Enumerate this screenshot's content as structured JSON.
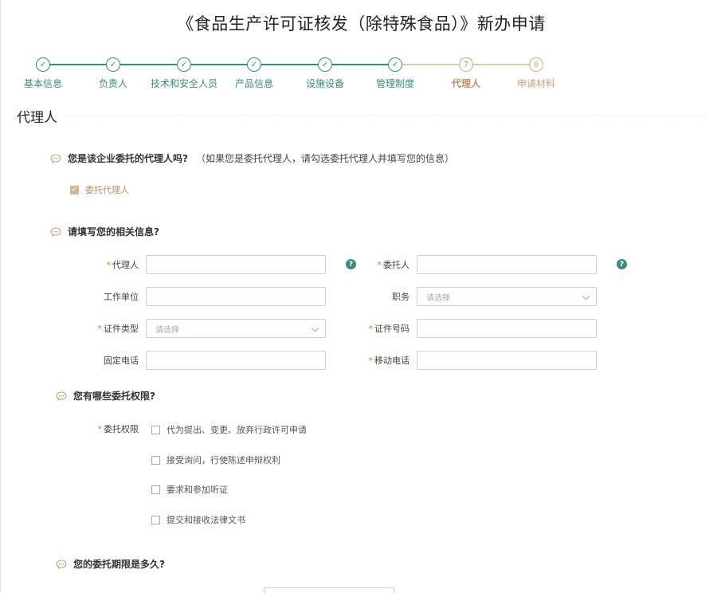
{
  "page_title": "《食品生产许可证核发（除特殊食品）》新办申请",
  "steps": [
    {
      "label": "基本信息",
      "marker": "✓",
      "state": "done"
    },
    {
      "label": "负责人",
      "marker": "✓",
      "state": "done"
    },
    {
      "label": "技术和安全人员",
      "marker": "✓",
      "state": "done"
    },
    {
      "label": "产品信息",
      "marker": "✓",
      "state": "done"
    },
    {
      "label": "设施设备",
      "marker": "✓",
      "state": "done"
    },
    {
      "label": "管理制度",
      "marker": "✓",
      "state": "done"
    },
    {
      "label": "代理人",
      "marker": "7",
      "state": "active"
    },
    {
      "label": "申请材料",
      "marker": "8",
      "state": "pending"
    }
  ],
  "section_title": "代理人",
  "q1": {
    "text": "您是该企业委托的代理人吗?",
    "note": "（如果您是委托代理人，请勾选委托代理人并填写您的信息）",
    "checkbox_label": "委托代理人",
    "checked": true
  },
  "q2": {
    "text": "请填写您的相关信息?",
    "fields": {
      "agent_label": "代理人",
      "agent_value": "",
      "principal_label": "委托人",
      "principal_value": "",
      "employer_label": "工作单位",
      "employer_value": "",
      "position_label": "职务",
      "position_placeholder": "请选择",
      "id_type_label": "证件类型",
      "id_type_placeholder": "请选择",
      "id_number_label": "证件号码",
      "id_number_value": "",
      "landline_label": "固定电话",
      "landline_value": "",
      "mobile_label": "移动电话",
      "mobile_value": ""
    },
    "help_glyph": "?",
    "required_mark": "*"
  },
  "q3": {
    "text": "您有哪些委托权限?",
    "label": "委托权限",
    "options": [
      {
        "label": "代为提出、变更、放弃行政许可申请",
        "checked": false
      },
      {
        "label": "接受询问，行使陈述申辩权利",
        "checked": false
      },
      {
        "label": "要求和参加听证",
        "checked": false
      },
      {
        "label": "提交和接收法律文书",
        "checked": false
      }
    ]
  },
  "q4": {
    "text": "您的委托期限是多久?"
  },
  "colors": {
    "accent_teal": "#3c8b80",
    "accent_brown": "#b9916a",
    "required": "#d9822b"
  }
}
